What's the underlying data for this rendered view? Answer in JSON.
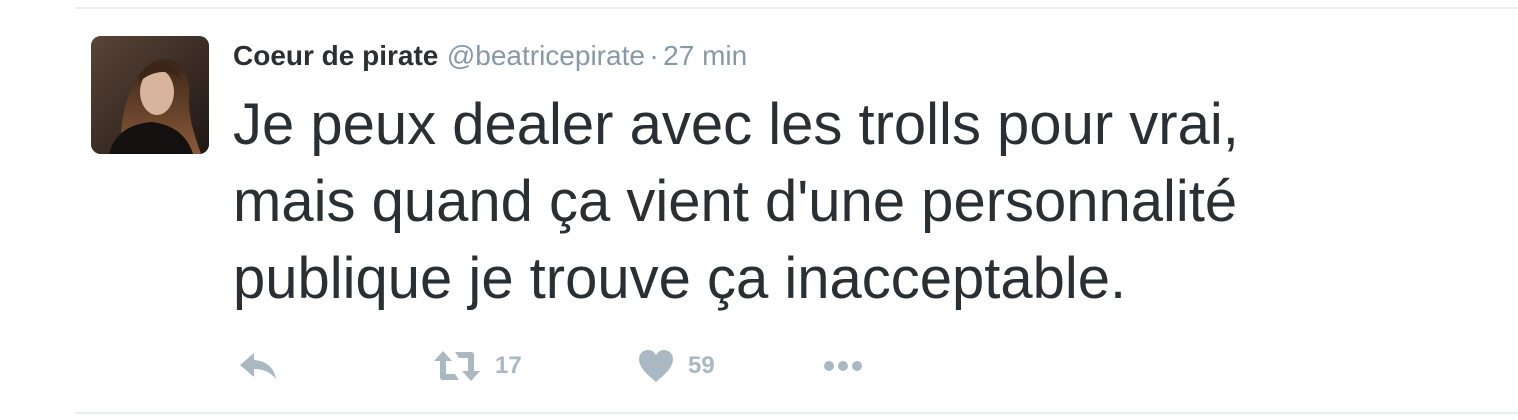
{
  "tweet": {
    "display_name": "Coeur de pirate",
    "handle": "@beatricepirate",
    "separator": "·",
    "time": "27 min",
    "text": "Je peux dealer avec les trolls pour vrai,\nmais quand ça vient d'une personnalité\npublique je trouve ça inacceptable.",
    "avatar_icon": "profile-photo"
  },
  "actions": {
    "reply_icon": "reply-icon",
    "retweet_icon": "retweet-icon",
    "retweet_count": "17",
    "like_icon": "heart-icon",
    "like_count": "59",
    "more_icon": "more-dots-icon"
  },
  "colors": {
    "text": "#292f33",
    "muted": "#8899a6",
    "action": "#aab8c2",
    "divider": "#e6ecf0"
  }
}
